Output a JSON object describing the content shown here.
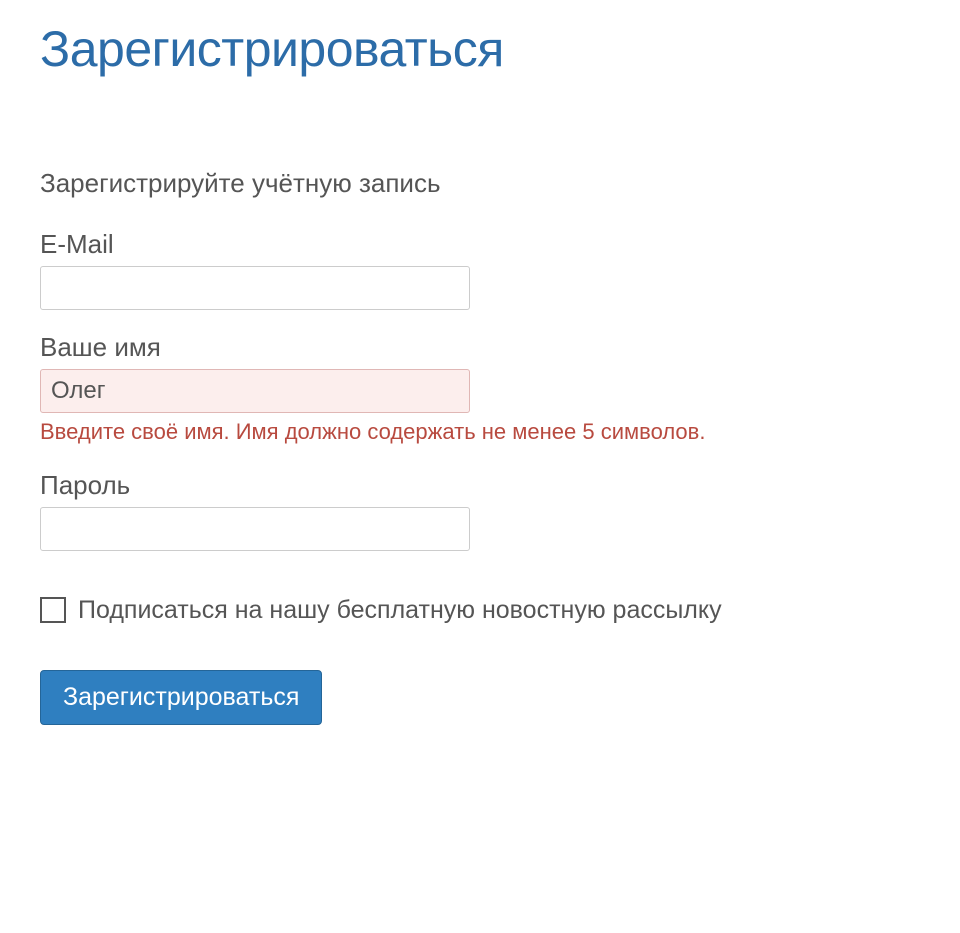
{
  "page": {
    "title": "Зарегистрироваться",
    "subheading": "Зарегистрируйте учётную запись"
  },
  "form": {
    "email": {
      "label": "E-Mail",
      "value": ""
    },
    "name": {
      "label": "Ваше имя",
      "value": "Олег",
      "error": "Введите своё имя. Имя должно содержать не менее 5 символов."
    },
    "password": {
      "label": "Пароль",
      "value": ""
    },
    "newsletter": {
      "label": "Подписаться на нашу бесплатную новостную рассылку",
      "checked": false
    },
    "submit_label": "Зарегистрироваться"
  }
}
